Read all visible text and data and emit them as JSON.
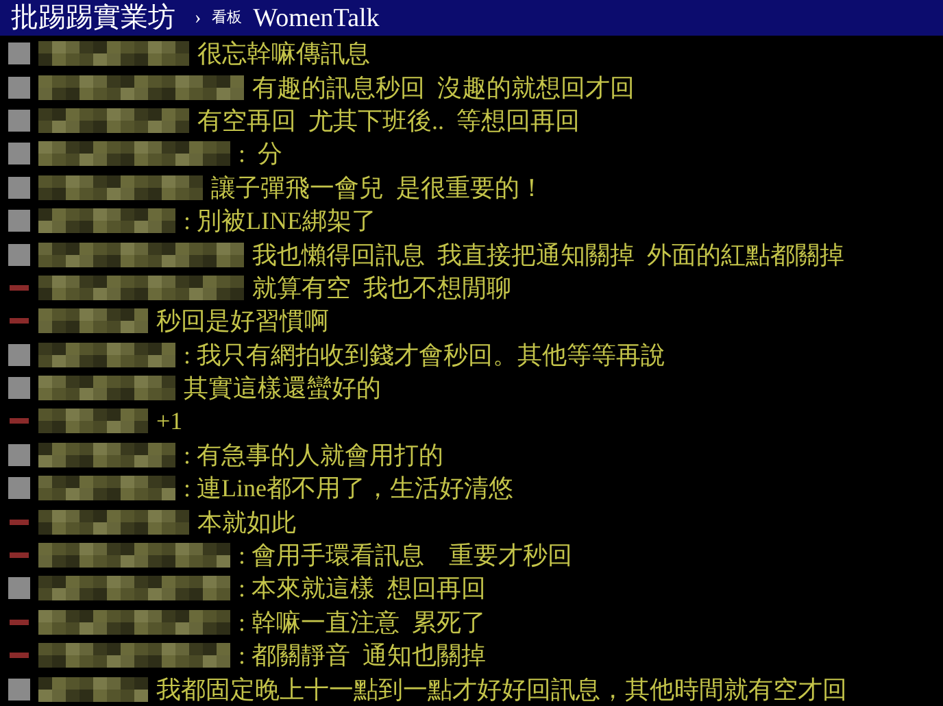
{
  "header": {
    "site": "批踢踢實業坊",
    "separator": "›",
    "board_label": "看板",
    "board": "WomenTalk"
  },
  "comments": [
    {
      "kind": "push",
      "text": "很忘幹嘛傳訊息"
    },
    {
      "kind": "push",
      "text": "有趣的訊息秒回  沒趣的就想回才回"
    },
    {
      "kind": "push",
      "text": "有空再回  尤其下班後..  等想回再回"
    },
    {
      "kind": "push",
      "text": ":  分"
    },
    {
      "kind": "push",
      "text": "讓子彈飛一會兒  是很重要的！"
    },
    {
      "kind": "push",
      "text": ": 別被LINE綁架了"
    },
    {
      "kind": "push",
      "text": "我也懶得回訊息  我直接把通知關掉  外面的紅點都關掉"
    },
    {
      "kind": "arrow",
      "text": "就算有空  我也不想閒聊"
    },
    {
      "kind": "arrow",
      "text": "秒回是好習慣啊"
    },
    {
      "kind": "push",
      "text": ": 我只有網拍收到錢才會秒回。其他等等再說"
    },
    {
      "kind": "push",
      "text": "其實這樣還蠻好的"
    },
    {
      "kind": "arrow",
      "text": "+1"
    },
    {
      "kind": "push",
      "text": ": 有急事的人就會用打的"
    },
    {
      "kind": "push",
      "text": ": 連Line都不用了，生活好清悠"
    },
    {
      "kind": "arrow",
      "text": "本就如此"
    },
    {
      "kind": "arrow",
      "text": ": 會用手環看訊息    重要才秒回"
    },
    {
      "kind": "push",
      "text": ": 本來就這樣  想回再回"
    },
    {
      "kind": "arrow",
      "text": ": 幹嘛一直注意  累死了"
    },
    {
      "kind": "arrow",
      "text": ": 都關靜音  通知也關掉"
    },
    {
      "kind": "push",
      "text": "我都固定晚上十一點到一點才好好回訊息，其他時間就有空才回"
    }
  ]
}
